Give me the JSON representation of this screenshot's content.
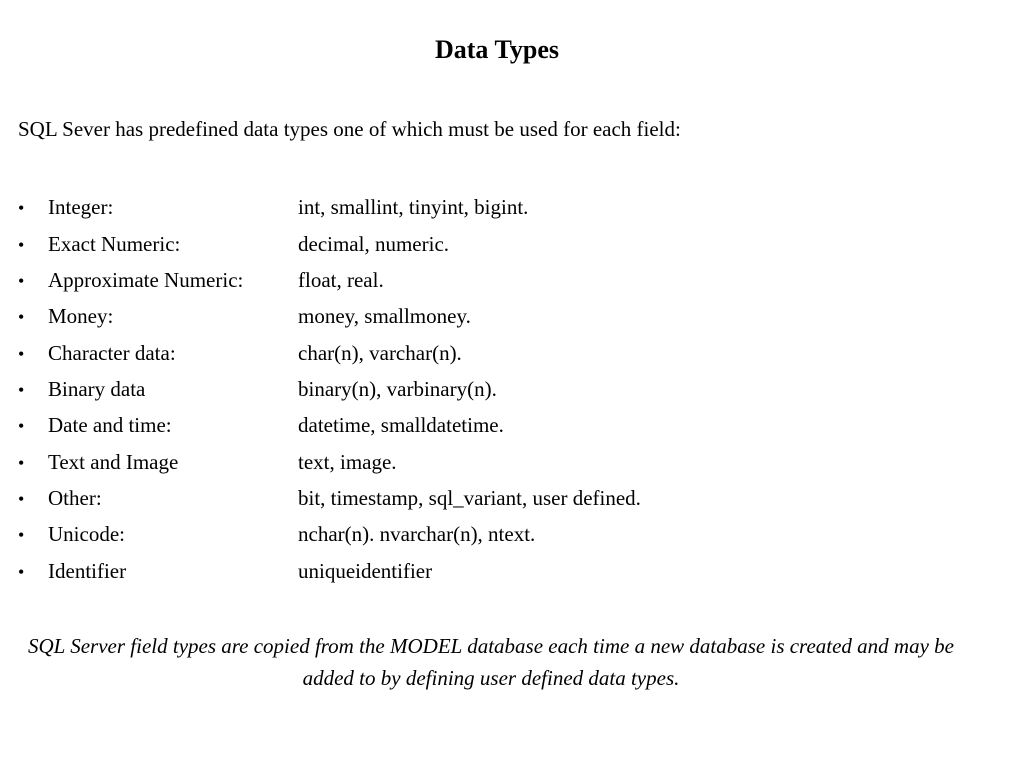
{
  "title": "Data Types",
  "intro": "SQL Sever has predefined data types one of which must be used for each field:",
  "rows": [
    {
      "category": "Integer:",
      "values": "int, smallint, tinyint, bigint."
    },
    {
      "category": "Exact Numeric:",
      "values": "decimal, numeric."
    },
    {
      "category": "Approximate Numeric:",
      "values": "float, real."
    },
    {
      "category": "Money:",
      "values": "money, smallmoney."
    },
    {
      "category": "Character data:",
      "values": "char(n), varchar(n)."
    },
    {
      "category": "Binary data",
      "values": "binary(n), varbinary(n)."
    },
    {
      "category": "Date and time:",
      "values": "datetime, smalldatetime."
    },
    {
      "category": "Text and Image",
      "values": "text, image."
    },
    {
      "category": "Other:",
      "values": "bit, timestamp, sql_variant, user defined."
    },
    {
      "category": "Unicode:",
      "values": "nchar(n). nvarchar(n), ntext."
    },
    {
      "category": "Identifier",
      "values": "uniqueidentifier"
    }
  ],
  "footnote": "SQL Server field types are copied from the MODEL database each time a new database is created and may be added to by defining user defined data types."
}
